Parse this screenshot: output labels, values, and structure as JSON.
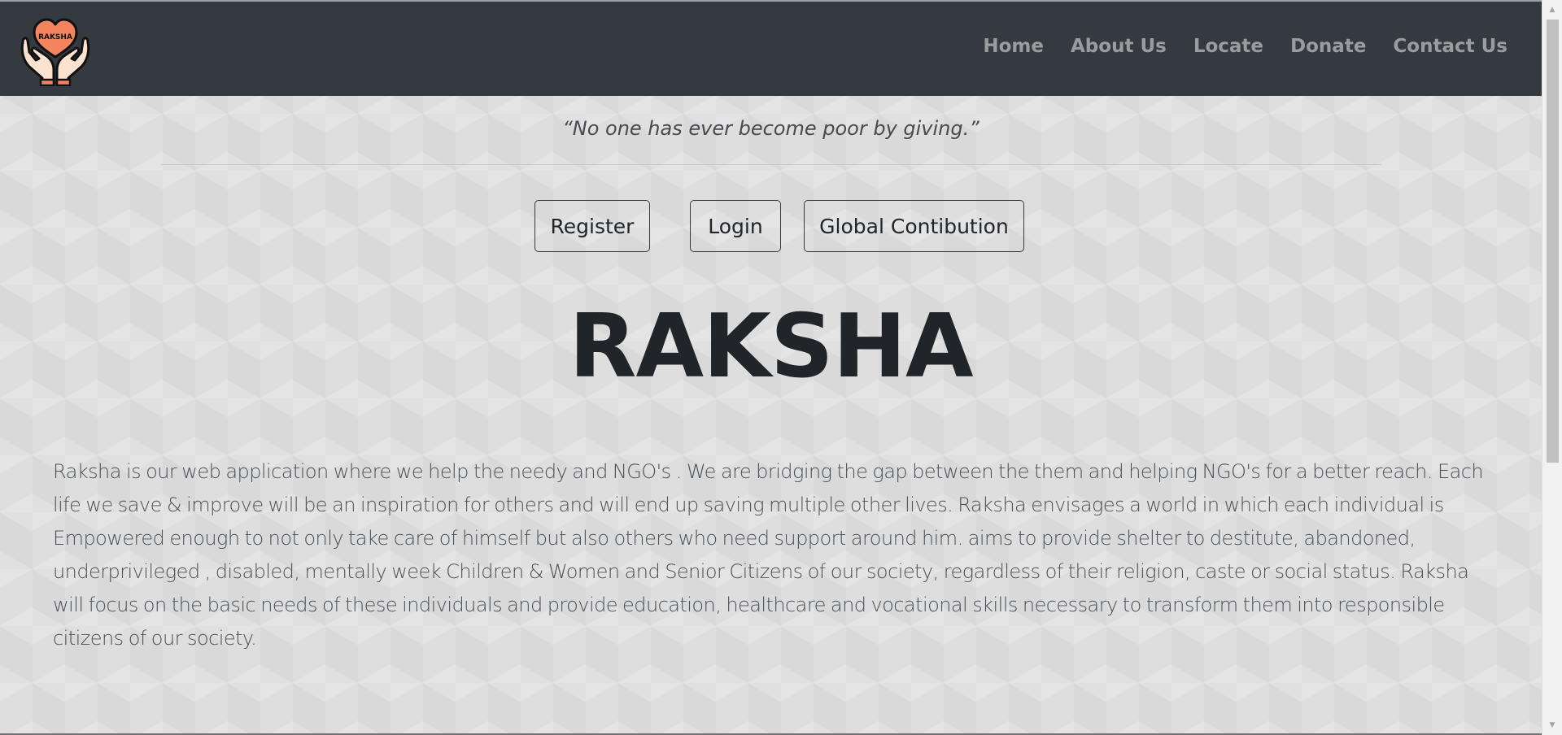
{
  "navbar": {
    "logo_text": "RAKSHA",
    "links": [
      "Home",
      "About Us",
      "Locate",
      "Donate",
      "Contact Us"
    ],
    "background_color": "#343a40",
    "link_color": "#9a9da0"
  },
  "quote": "“No one has ever become poor by giving.”",
  "buttons": {
    "register": "Register",
    "login": "Login",
    "global": "Global Contibution"
  },
  "hero": {
    "title": "RAKSHA"
  },
  "description": "Raksha is our web application where we help the needy and NGO's . We are bridging the gap between the them and helping NGO's for a better reach. Each life we save & improve will be an inspiration for others and will end up saving multiple other lives. Raksha envisages a world in which each individual is Empowered enough to not only take care of himself but also others who need support around him. aims to provide shelter to destitute, abandoned, underprivileged , disabled, mentally week Children & Women and Senior Citizens of our society, regardless of their religion, caste or social status. Raksha will focus on the basic needs of these individuals and provide education, healthcare and vocational skills necessary to transform them into responsible citizens of our society.",
  "icons": {
    "logo": "heart-in-hands-icon",
    "scroll_up": "scroll-up-arrow-icon",
    "scroll_down": "scroll-down-arrow-icon"
  },
  "colors": {
    "logo_heart": "#f4845f",
    "logo_hands": "#fbe3cf",
    "title": "#212529"
  }
}
